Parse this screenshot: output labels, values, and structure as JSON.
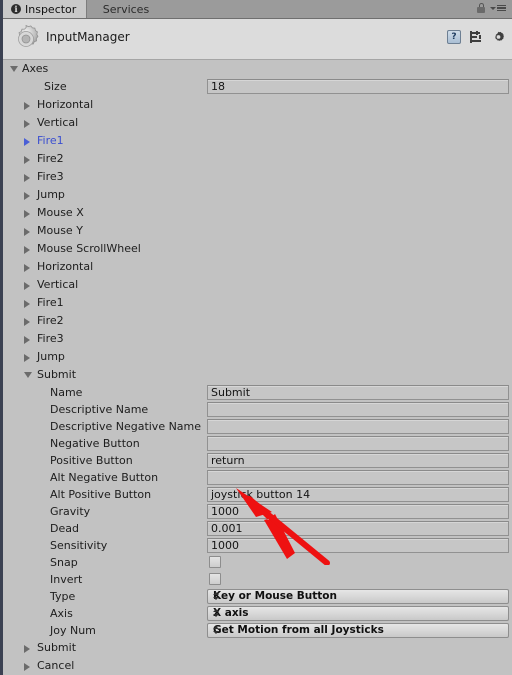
{
  "window": {
    "tabs": [
      {
        "label": "Inspector",
        "icon": "info-icon",
        "active": true
      },
      {
        "label": "Services",
        "icon": null,
        "active": false
      }
    ],
    "lock_icon": "lock-icon",
    "menu_icon": "hamburger-menu-icon"
  },
  "header": {
    "title": "InputManager",
    "asset_icon": "gear-icon",
    "help_icon": "help-icon",
    "preset_icon": "preset-icon",
    "settings_icon": "gear-icon"
  },
  "tree": {
    "root": {
      "label": "Axes",
      "expanded": true
    },
    "size": {
      "label": "Size",
      "value": "18"
    },
    "items": [
      {
        "label": "Horizontal",
        "expanded": false,
        "selected": false
      },
      {
        "label": "Vertical",
        "expanded": false,
        "selected": false
      },
      {
        "label": "Fire1",
        "expanded": false,
        "selected": true
      },
      {
        "label": "Fire2",
        "expanded": false,
        "selected": false
      },
      {
        "label": "Fire3",
        "expanded": false,
        "selected": false
      },
      {
        "label": "Jump",
        "expanded": false,
        "selected": false
      },
      {
        "label": "Mouse X",
        "expanded": false,
        "selected": false
      },
      {
        "label": "Mouse Y",
        "expanded": false,
        "selected": false
      },
      {
        "label": "Mouse ScrollWheel",
        "expanded": false,
        "selected": false
      },
      {
        "label": "Horizontal",
        "expanded": false,
        "selected": false
      },
      {
        "label": "Vertical",
        "expanded": false,
        "selected": false
      },
      {
        "label": "Fire1",
        "expanded": false,
        "selected": false
      },
      {
        "label": "Fire2",
        "expanded": false,
        "selected": false
      },
      {
        "label": "Fire3",
        "expanded": false,
        "selected": false
      },
      {
        "label": "Jump",
        "expanded": false,
        "selected": false
      },
      {
        "label": "Submit",
        "expanded": true,
        "selected": false
      }
    ],
    "trailing": [
      {
        "label": "Submit",
        "expanded": false
      },
      {
        "label": "Cancel",
        "expanded": false
      }
    ]
  },
  "submit_axis": {
    "fields": [
      {
        "label": "Name",
        "value": "Submit",
        "type": "text"
      },
      {
        "label": "Descriptive Name",
        "value": "",
        "type": "text"
      },
      {
        "label": "Descriptive Negative Name",
        "value": "",
        "type": "text"
      },
      {
        "label": "Negative Button",
        "value": "",
        "type": "text"
      },
      {
        "label": "Positive Button",
        "value": "return",
        "type": "text"
      },
      {
        "label": "Alt Negative Button",
        "value": "",
        "type": "text"
      },
      {
        "label": "Alt Positive Button",
        "value": "joystick button 14",
        "type": "text"
      },
      {
        "label": "Gravity",
        "value": "1000",
        "type": "text"
      },
      {
        "label": "Dead",
        "value": "0.001",
        "type": "text"
      },
      {
        "label": "Sensitivity",
        "value": "1000",
        "type": "text"
      },
      {
        "label": "Snap",
        "value": "",
        "type": "checkbox",
        "checked": false
      },
      {
        "label": "Invert",
        "value": "",
        "type": "checkbox",
        "checked": false
      },
      {
        "label": "Type",
        "value": "Key or Mouse Button",
        "type": "dropdown"
      },
      {
        "label": "Axis",
        "value": "X axis",
        "type": "dropdown"
      },
      {
        "label": "Joy Num",
        "value": "Get Motion from all Joysticks",
        "type": "dropdown"
      }
    ]
  },
  "annotation": {
    "arrow_color": "#ee1111",
    "points_at": "Alt Positive Button"
  },
  "colors": {
    "panel_bg": "#c2c2c2",
    "header_bg": "#dcdcdc",
    "tabbar_bg": "#9b9b9b",
    "selected_text": "#3b4fd0",
    "accent_red": "#ee1111"
  }
}
